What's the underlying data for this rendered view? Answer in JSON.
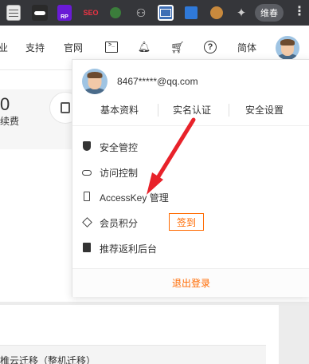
{
  "browser": {
    "extensions": [
      {
        "name": "notes-ext-icon"
      },
      {
        "name": "mask-ext-icon"
      },
      {
        "name": "rp-ext-icon",
        "label": "RP"
      },
      {
        "name": "seo-ext-icon",
        "label": "SEO"
      },
      {
        "name": "plant-ext-icon"
      },
      {
        "name": "figures-ext-icon"
      },
      {
        "name": "window-ext-icon"
      },
      {
        "name": "book-ext-icon"
      },
      {
        "name": "cookie-ext-icon"
      },
      {
        "name": "puzzle-ext-icon"
      }
    ],
    "profile_label": "维春",
    "menu_icon": "kebab-icon"
  },
  "header": {
    "nav_partial": "业",
    "nav_support": "支持",
    "nav_official": "官网",
    "icons": [
      "terminal-icon",
      "bell-icon",
      "cart-icon",
      "help-icon"
    ],
    "lang": "简体"
  },
  "background": {
    "partial_number": "0",
    "partial_text": "续费",
    "lower_text": "椎云迁移（整机迁移）"
  },
  "dropdown": {
    "email": "8467*****@qq.com",
    "links": [
      "基本资料",
      "实名认证",
      "安全设置"
    ],
    "menu": [
      {
        "icon": "shield-icon",
        "label": "安全管控"
      },
      {
        "icon": "cloud-icon",
        "label": "访问控制"
      },
      {
        "icon": "key-icon",
        "label": "AccessKey 管理"
      },
      {
        "icon": "diamond-icon",
        "label": "会员积分",
        "action": "签到"
      },
      {
        "icon": "document-icon",
        "label": "推荐返利后台"
      }
    ],
    "logout": "退出登录"
  },
  "colors": {
    "accent": "#ff6a00",
    "arrow": "#e8222a",
    "browser_bar": "#35363a"
  }
}
